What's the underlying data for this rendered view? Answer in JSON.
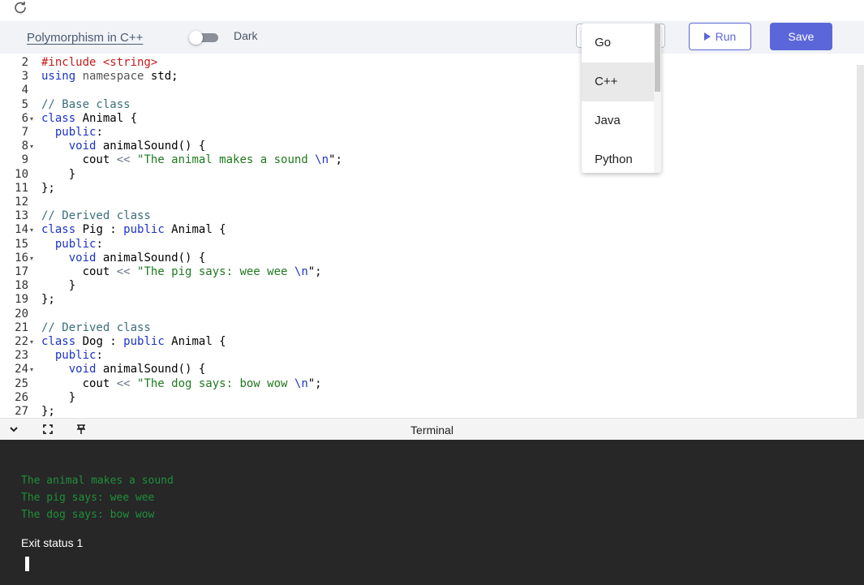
{
  "header": {
    "reload_icon": "reload-icon",
    "title": "Polymorphism in C++",
    "theme_toggle_label": "Dark",
    "theme_toggle_on": false,
    "run_label": "Run",
    "save_label": "Save",
    "accent_color": "#5b67d8"
  },
  "language_dropdown": {
    "options": [
      "Go",
      "C++",
      "Java",
      "Python"
    ],
    "highlighted": "C++"
  },
  "editor": {
    "lines": [
      {
        "n": "2",
        "fold": false
      },
      {
        "n": "3",
        "fold": false
      },
      {
        "n": "4",
        "fold": false
      },
      {
        "n": "5",
        "fold": false
      },
      {
        "n": "6",
        "fold": true
      },
      {
        "n": "7",
        "fold": false
      },
      {
        "n": "8",
        "fold": true
      },
      {
        "n": "9",
        "fold": false
      },
      {
        "n": "10",
        "fold": false
      },
      {
        "n": "11",
        "fold": false
      },
      {
        "n": "12",
        "fold": false
      },
      {
        "n": "13",
        "fold": false
      },
      {
        "n": "14",
        "fold": true
      },
      {
        "n": "15",
        "fold": false
      },
      {
        "n": "16",
        "fold": true
      },
      {
        "n": "17",
        "fold": false
      },
      {
        "n": "18",
        "fold": false
      },
      {
        "n": "19",
        "fold": false
      },
      {
        "n": "20",
        "fold": false
      },
      {
        "n": "21",
        "fold": false
      },
      {
        "n": "22",
        "fold": true
      },
      {
        "n": "23",
        "fold": false
      },
      {
        "n": "24",
        "fold": true
      },
      {
        "n": "25",
        "fold": false
      },
      {
        "n": "26",
        "fold": false
      },
      {
        "n": "27",
        "fold": false
      }
    ],
    "code": [
      [
        [
          "inc",
          "#include "
        ],
        [
          "inc",
          "<string>"
        ]
      ],
      [
        [
          "kw",
          "using"
        ],
        [
          "",
          " "
        ],
        [
          "ns",
          "namespace"
        ],
        [
          "",
          " std;"
        ]
      ],
      [],
      [
        [
          "cm",
          "// Base class"
        ]
      ],
      [
        [
          "kw",
          "class"
        ],
        [
          "",
          " Animal {"
        ]
      ],
      [
        [
          "",
          "  "
        ],
        [
          "kw",
          "public"
        ],
        [
          "",
          ":"
        ]
      ],
      [
        [
          "",
          "    "
        ],
        [
          "kw",
          "void"
        ],
        [
          "",
          " animalSound() {"
        ]
      ],
      [
        [
          "",
          "      cout "
        ],
        [
          "op",
          "<<"
        ],
        [
          "",
          " "
        ],
        [
          "st",
          "\"The animal makes a sound "
        ],
        [
          "kw",
          "\\n"
        ],
        [
          "",
          "\";"
        ]
      ],
      [
        [
          "",
          "    }"
        ]
      ],
      [
        [
          "",
          "};"
        ]
      ],
      [],
      [
        [
          "cm",
          "// Derived class"
        ]
      ],
      [
        [
          "kw",
          "class"
        ],
        [
          "",
          " Pig : "
        ],
        [
          "kw",
          "public"
        ],
        [
          "",
          " Animal {"
        ]
      ],
      [
        [
          "",
          "  "
        ],
        [
          "kw",
          "public"
        ],
        [
          "",
          ":"
        ]
      ],
      [
        [
          "",
          "    "
        ],
        [
          "kw",
          "void"
        ],
        [
          "",
          " animalSound() {"
        ]
      ],
      [
        [
          "",
          "      cout "
        ],
        [
          "op",
          "<<"
        ],
        [
          "",
          " "
        ],
        [
          "st",
          "\"The pig says: wee wee "
        ],
        [
          "kw",
          "\\n"
        ],
        [
          "",
          "\";"
        ]
      ],
      [
        [
          "",
          "    }"
        ]
      ],
      [
        [
          "",
          "};"
        ]
      ],
      [],
      [
        [
          "cm",
          "// Derived class"
        ]
      ],
      [
        [
          "kw",
          "class"
        ],
        [
          "",
          " Dog : "
        ],
        [
          "kw",
          "public"
        ],
        [
          "",
          " Animal {"
        ]
      ],
      [
        [
          "",
          "  "
        ],
        [
          "kw",
          "public"
        ],
        [
          "",
          ":"
        ]
      ],
      [
        [
          "",
          "    "
        ],
        [
          "kw",
          "void"
        ],
        [
          "",
          " animalSound() {"
        ]
      ],
      [
        [
          "",
          "      cout "
        ],
        [
          "op",
          "<<"
        ],
        [
          "",
          " "
        ],
        [
          "st",
          "\"The dog says: bow wow "
        ],
        [
          "kw",
          "\\n"
        ],
        [
          "",
          "\";"
        ]
      ],
      [
        [
          "",
          "    }"
        ]
      ],
      [
        [
          "",
          "};"
        ]
      ]
    ]
  },
  "terminal": {
    "title": "Terminal",
    "collapse_icon": "chevron-down-icon",
    "expand_icon": "expand-icon",
    "pin_icon": "pin-icon",
    "output": [
      "The animal makes a sound",
      "The pig says: wee wee",
      "The dog says: bow wow"
    ],
    "exit_status": "Exit status 1"
  }
}
